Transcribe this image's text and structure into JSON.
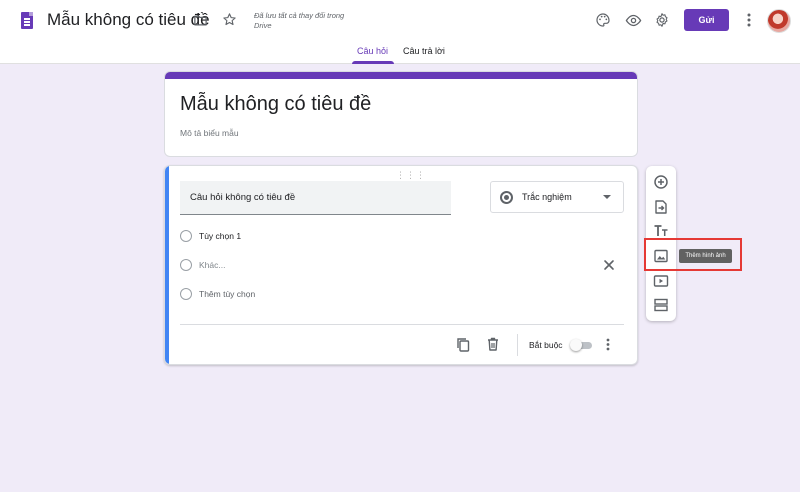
{
  "header": {
    "doc_title": "Mẫu không có tiêu đề",
    "save_status": "Đã lưu tất cả thay đổi trong Drive",
    "send_label": "Gửi"
  },
  "tabs": [
    {
      "label": "Câu hỏi",
      "active": true
    },
    {
      "label": "Câu trả lời",
      "active": false
    }
  ],
  "form": {
    "title": "Mẫu không có tiêu đề",
    "description_placeholder": "Mô tả biểu mẫu"
  },
  "question": {
    "title": "Câu hỏi không có tiêu đề",
    "type": "Trắc nghiệm",
    "options": [
      "Tùy chọn 1",
      "Khác...",
      "Thêm tùy chọn"
    ],
    "required_label": "Bắt buộc",
    "required": false
  },
  "toolbar": {
    "tooltip": "Thêm hình ảnh",
    "items": [
      "add-question",
      "import-questions",
      "add-title",
      "add-image",
      "add-video",
      "add-section"
    ]
  },
  "colors": {
    "accent": "#673ab7",
    "background": "#f0ebf8",
    "question_border": "#4285f4",
    "highlight": "#e53935"
  }
}
